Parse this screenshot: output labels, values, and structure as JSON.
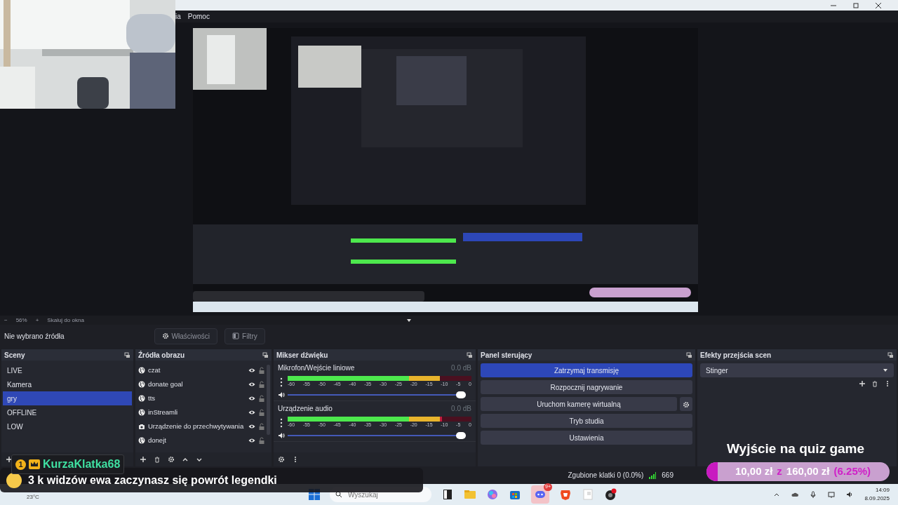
{
  "window": {
    "menu": [
      "ia",
      "Pomoc"
    ]
  },
  "preview": {
    "zoom_out": "−",
    "zoom": "56%",
    "zoom_in": "+",
    "scale_mode": "Skaluj do okna"
  },
  "source_toolbar": {
    "label": "Nie wybrano źródła",
    "buttons": [
      "Właściwości",
      "Filtry"
    ]
  },
  "scenes": {
    "title": "Sceny",
    "items": [
      {
        "label": "LIVE",
        "selected": false
      },
      {
        "label": "Kamera",
        "selected": false
      },
      {
        "label": "gry",
        "selected": true
      },
      {
        "label": "OFFLINE",
        "selected": false
      },
      {
        "label": "LOW",
        "selected": false
      }
    ]
  },
  "sources": {
    "title": "Źródła obrazu",
    "items": [
      {
        "label": "czat",
        "kind": "browser",
        "visible": true,
        "locked": false
      },
      {
        "label": "donate goal",
        "kind": "browser",
        "visible": true,
        "locked": false
      },
      {
        "label": "tts",
        "kind": "browser",
        "visible": true,
        "locked": false
      },
      {
        "label": "inStreamli",
        "kind": "browser",
        "visible": true,
        "locked": false
      },
      {
        "label": "Urządzenie do przechwytywania",
        "kind": "camera",
        "visible": true,
        "locked": false
      },
      {
        "label": "donejt",
        "kind": "browser",
        "visible": true,
        "locked": false
      }
    ]
  },
  "mixer": {
    "title": "Mikser dźwięku",
    "channels": [
      {
        "name": "Mikrofon/Wejście liniowe",
        "reading": "0.0 dB",
        "meter": {
          "level": 0.83
        },
        "fader": {
          "level": 1
        },
        "scale": [
          "-60",
          "-55",
          "-50",
          "-45",
          "-40",
          "-35",
          "-30",
          "-25",
          "-20",
          "-15",
          "-10",
          "-5",
          "0"
        ]
      },
      {
        "name": "Urządzenie audio",
        "reading": "0.0 dB",
        "meter": {
          "level": 0.84
        },
        "fader": {
          "level": 1
        },
        "scale": [
          "-60",
          "-55",
          "-50",
          "-45",
          "-40",
          "-35",
          "-30",
          "-25",
          "-20",
          "-15",
          "-10",
          "-5",
          "0"
        ]
      }
    ]
  },
  "controls": {
    "title": "Panel sterujący",
    "buttons": [
      {
        "label": "Zatrzymaj transmisję",
        "active": true,
        "has_settings": false
      },
      {
        "label": "Rozpocznij nagrywanie",
        "active": false,
        "has_settings": false
      },
      {
        "label": "Uruchom kamerę wirtualną",
        "active": false,
        "has_settings": true
      },
      {
        "label": "Tryb studia",
        "active": false,
        "has_settings": false
      },
      {
        "label": "Ustawienia",
        "active": false,
        "has_settings": false
      }
    ]
  },
  "transitions": {
    "title": "Efekty przejścia scen",
    "value": "Stinger"
  },
  "status_bar": {
    "dropped": "Zgubione klatki 0 (0.0%)",
    "bitrate": "669"
  },
  "chat": {
    "badge": "1",
    "user": "KurzaKlatka68",
    "message": "3 k widzów ewa zaczynasz się powrót legendki"
  },
  "weather": {
    "temperature": "23°C"
  },
  "goal": {
    "title": "Wyjście na quiz game",
    "current": "10,00 zł",
    "separator": "z",
    "target": "160,00 zł",
    "percent": "(6.25%)",
    "level": 0.0625
  },
  "taskbar": {
    "search_placeholder": "Wyszukaj",
    "discord_badge": "9+",
    "time": "14:09",
    "date": "8.09.2025"
  }
}
